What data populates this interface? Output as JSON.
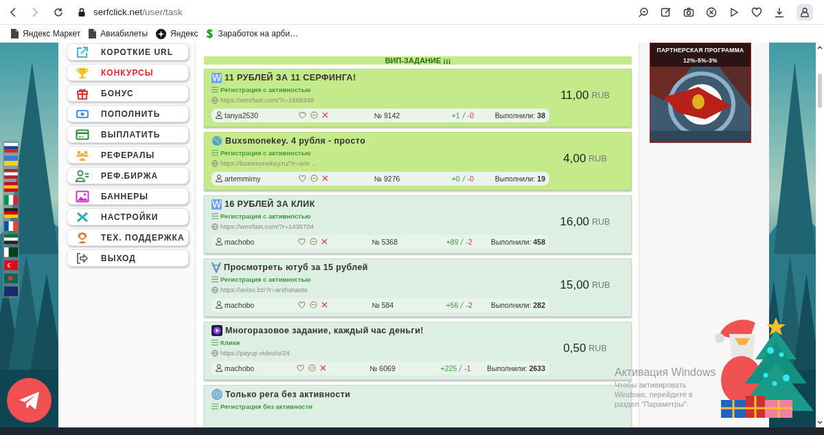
{
  "browser": {
    "address": {
      "host": "serfclick.net",
      "path": "/user/task"
    }
  },
  "bookmarks": [
    {
      "kind": "page",
      "label": "Яндекс Маркет"
    },
    {
      "kind": "page",
      "label": "Авиабилеты"
    },
    {
      "kind": "star",
      "label": "Яндекс"
    },
    {
      "kind": "money",
      "label": "Заработок на арби…"
    }
  ],
  "menu": [
    {
      "label": "КОРОТКИЕ URL",
      "selected": false
    },
    {
      "label": "КОНКУРСЫ",
      "selected": true
    },
    {
      "label": "БОНУС",
      "selected": false
    },
    {
      "label": "ПОПОЛНИТЬ",
      "selected": false
    },
    {
      "label": "ВЫПЛАТИТЬ",
      "selected": false
    },
    {
      "label": "РЕФЕРАЛЫ",
      "selected": false
    },
    {
      "label": "РЕФ.БИРЖА",
      "selected": false
    },
    {
      "label": "БАННЕРЫ",
      "selected": false
    },
    {
      "label": "НАСТРОЙКИ",
      "selected": false
    },
    {
      "label": "ТЕХ. ПОДДЕРЖКА",
      "selected": false
    },
    {
      "label": "ВЫХОД",
      "selected": false
    }
  ],
  "vip_header": "ВИП-ЗАДАНИЕ ¡¡¡",
  "tasks": [
    {
      "kind": "letter",
      "badge": "W",
      "vip": true,
      "title": "11 РУБЛЕЙ ЗА 11 СЕРФИНГА!",
      "category": "Регистрация с активностью",
      "url": "https://wmrfast.com/?r=1558349",
      "user": "tanya2530",
      "number": "№ 9142",
      "likes": "+1",
      "dislikes": "-0",
      "done": "Выполнили: **38**",
      "price": "11,00",
      "currency": "RUB"
    },
    {
      "kind": "globe",
      "vip": true,
      "title": "Buxsmonekey. 4 рубля - просто",
      "category": "Регистрация с активностью",
      "url": "https://buxsmonekey.ru/?r=arte ...",
      "user": "artemmirny",
      "number": "№ 9276",
      "likes": "+0",
      "dislikes": "-0",
      "done": "Выполнили: **19**",
      "price": "4,00",
      "currency": "RUB"
    },
    {
      "kind": "letter",
      "badge": "W",
      "vip": false,
      "title": "16 РУБЛЕЙ ЗА КЛИК",
      "category": "Регистрация с активностью",
      "url": "https://wmrfast.com/?r=1435704",
      "user": "machobo",
      "number": "№ 5368",
      "likes": "+89",
      "dislikes": "-2",
      "done": "Выполнили: **458**",
      "price": "16,00",
      "currency": "RUB"
    },
    {
      "kind": "vee",
      "vip": false,
      "title": "Просмотреть ютуб за 15 рублей",
      "category": "Регистрация с активностью",
      "url": "https://aviso.bz/?r=arshonaste",
      "user": "machobo",
      "number": "№ 584",
      "likes": "+56",
      "dislikes": "-2",
      "done": "Выполнили: **282**",
      "price": "15,00",
      "currency": "RUB"
    },
    {
      "kind": "play",
      "vip": false,
      "title": "Многоразовое задание, каждый час деньги!",
      "category": "Клики",
      "url": "https://payup.video/u/24",
      "user": "machobo",
      "number": "№ 6069",
      "likes": "+225",
      "dislikes": "-1",
      "done": "Выполнили: **2633**",
      "price": "0,50",
      "currency": "RUB"
    },
    {
      "kind": "rings",
      "vip": false,
      "title": "Только рега без активности",
      "category": "Регистрация без активности"
    }
  ],
  "banner": {
    "title": "ПАРТНЕРСКАЯ ПРОГРАММА",
    "subtitle": "12%-5%-3%"
  },
  "windows_notice": {
    "title": "Активация Windows",
    "text": "Чтобы активировать Windows, перейдите в раздел \"Параметры\"."
  }
}
